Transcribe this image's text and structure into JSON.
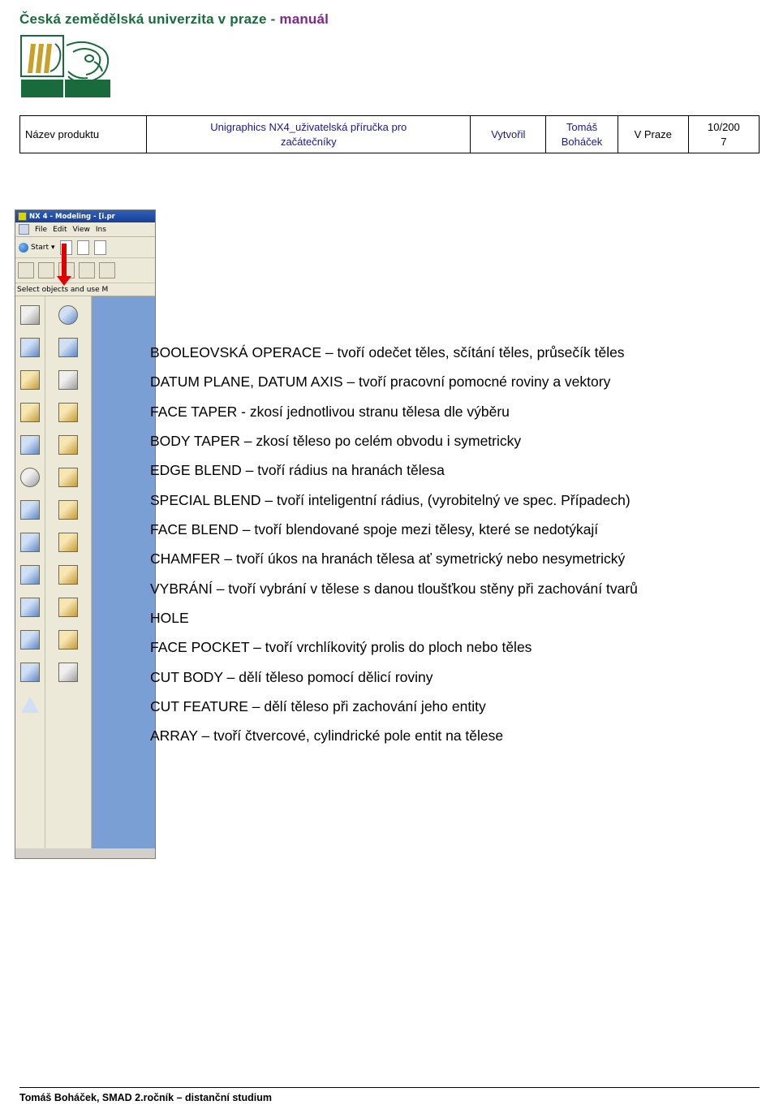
{
  "header": {
    "title_main": "Česká zemědělská univerzita v praze - ",
    "title_accent": "manuál"
  },
  "logo": {
    "alt": "czu-logo"
  },
  "info_table": {
    "label_product": "Název produktu",
    "product_line1": "Unigraphics NX4_uživatelská příručka pro",
    "product_line2": "začátečníky",
    "label_created_by": "Vytvořil",
    "author_line1": "Tomáš",
    "author_line2": "Boháček",
    "label_place": "V Praze",
    "date_line1": "10/200",
    "date_line2": "7"
  },
  "screenshot": {
    "window_title": "NX 4 - Modeling - [i.pr",
    "menu_items": [
      "File",
      "Edit",
      "View",
      "Ins"
    ],
    "start_button": "Start",
    "status_text": "Select objects and use M",
    "annotation": "red-down-arrow"
  },
  "content": {
    "paragraphs": [
      "BOOLEOVSKÁ OPERACE – tvoří odečet těles, sčítání těles, průsečík těles",
      "DATUM PLANE, DATUM AXIS – tvoří pracovní pomocné roviny a vektory",
      "FACE TAPER -  zkosí jednotlivou stranu tělesa dle výběru",
      "BODY TAPER – zkosí těleso po celém obvodu i symetricky",
      "EDGE BLEND – tvoří rádius na hranách tělesa",
      "SPECIAL BLEND – tvoří inteligentní rádius, (vyrobitelný ve spec. Případech)",
      "FACE BLEND – tvoří blendované spoje mezi tělesy, které se nedotýkají",
      "CHAMFER – tvoří úkos na hranách tělesa ať symetrický nebo nesymetrický",
      "VYBRÁNÍ – tvoří vybrání v tělese s danou tloušťkou stěny při zachování tvarů",
      "HOLE",
      "FACE POCKET  – tvoří vrchlíkovitý prolis do ploch nebo těles",
      "CUT BODY – dělí těleso pomocí dělicí roviny",
      "CUT FEATURE – dělí těleso při zachování jeho entity",
      "ARRAY – tvoří čtvercové, cylindrické pole entit na tělese"
    ]
  },
  "footer": {
    "text": "Tomáš Boháček, SMAD 2.ročník – distanční studium"
  },
  "colors": {
    "header_green": "#1a6b3c",
    "header_purple": "#7a2a8c",
    "table_blue": "#1a1a8c",
    "arrow_red": "#e00000"
  }
}
